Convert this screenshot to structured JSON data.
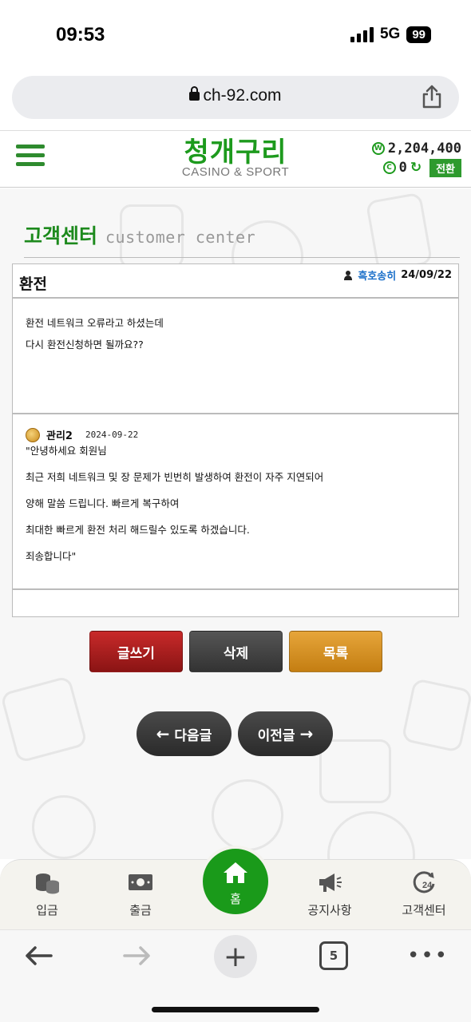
{
  "status": {
    "time": "09:53",
    "network": "5G",
    "battery": "99"
  },
  "browser": {
    "url": "ch-92.com",
    "tab_count": "5"
  },
  "header": {
    "logo_main": "청개구리",
    "logo_sub": "CASINO & SPORT",
    "balance_symbol": "W",
    "balance": "2,204,400",
    "point_symbol": "C",
    "points": "0",
    "convert_label": "전환",
    "brand_color": "#1d9a1d"
  },
  "page": {
    "title": "고객센터",
    "subtitle": "customer center"
  },
  "post": {
    "title": "환전",
    "author": "흑호송히",
    "date": "24/09/22",
    "body": [
      "환전 네트워크 오류라고 하셨는데",
      "다시 환전신청하면 될까요??"
    ]
  },
  "reply": {
    "author": "관리2",
    "date": "2024-09-22",
    "lines": [
      "\"안녕하세요 회원님",
      "최근 저희 네트워크 및 장 문제가 빈번히 발생하여 환전이 자주 지연되어",
      "양해 말씀 드립니다. 빠르게 복구하여",
      "최대한 빠르게 환전 처리 해드릴수 있도록 하겠습니다.",
      "죄송합니다\""
    ]
  },
  "actions": {
    "write": "글쓰기",
    "delete": "삭제",
    "list": "목록",
    "next": "다음글",
    "prev": "이전글"
  },
  "bottom_nav": {
    "deposit": "입금",
    "withdraw": "출금",
    "home": "홈",
    "notice": "공지사항",
    "support": "고객센터"
  }
}
